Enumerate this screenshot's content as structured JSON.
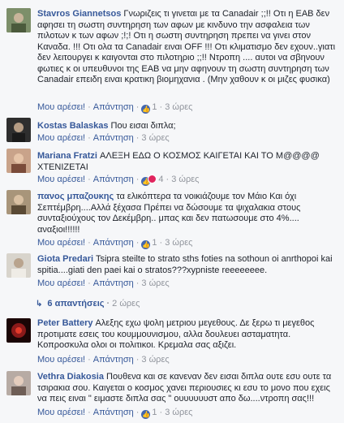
{
  "common": {
    "like_label": "Μου αρέσει!",
    "reply_label": "Απάντηση",
    "dot": "·"
  },
  "comments": [
    {
      "author": "Stavros Giannetsos",
      "text": "Γνωριζεις τι γινεται με τα Canadair ;;!! Οτι η ΕΑΒ δεν αφησει τη σωστη συντηρηση των αφων με κινδυνο την ασφαλεια των πιλοτων κ των αφων ;!;! Οτι η σωστη συντηρηση πρεπει να γινει στον Καναδα. !!! Οτι ολα τα Canadair ειναι OFF !!! Οτι κλιματισμο δεν εχουν..γιατι δεν λειτουργει κ καιγονται στο πιλοτηριο ;;!! Ντροπη .... αυτοι να σβηνουν φωτιες κ οι υπευθυνοι της ΕΑΒ να μην αφηνουν τη σωστη συντηρηση των Canadair επειδη ειναι κρατικη βιομηχανια . (Μην χαθουν κ οι μιζες φυσικα)",
      "reactions": "1",
      "time": "3 ώρες",
      "avatar_color": "#6b7f5a"
    },
    {
      "author": "Kostas Balaskas",
      "text": "Που εισαι διπλα;",
      "time": "3 ώρες",
      "avatar_color": "#3c3c3c"
    },
    {
      "author": "Mariana Fratzi",
      "text": "ΑΛΕΞΗ ΕΔΩ Ο ΚΟΣΜΟΣ ΚΑΙΓΕΤΑΙ ΚΑΙ ΤΟ Μ@@@@ ΧΤΕΝΙΖΕΤΑΙ",
      "reactions": "4",
      "time": "3 ώρες",
      "avatar_color": "#b2876a"
    },
    {
      "author": "πανος μπαζουκης",
      "text": "τα ελικόπτερα τα νοικιάζουμε τον Μάιο Και όχι Σεπτέμβρη....Αλλά ξέχασα Πρέπει να δώσουμε τα ψιχαλακια στους συνταξιούχους τον Δεκέμβρη.. μπας και δεν πατωσουμε στο 4%.... αναξιοι!!!!!!",
      "reactions": "1",
      "time": "3 ώρες",
      "avatar_color": "#8a7b5c"
    },
    {
      "author": "Giota Predari",
      "text": "Tsipra steilte to strato sths foties na sothoun oi anrthopoi kai spitia....giati den paei kai o stratos???xypniste reeeeeeee.",
      "time": "3 ώρες",
      "avatar_color": "#c9c6bf"
    },
    {
      "author": "Peter Battery",
      "text": "Αλεξης εχω ψολη μετριου μεγεθους. Δε ξερω τι μεγεθος προτιματε εσεις του κουμμουνισμου, αλλα δουλευει ασταματητα. Κοπροσκυλα ολοι οι πολιτικοι. Κρεμαλα σας αξιζει.",
      "time": "3 ώρες",
      "avatar_color": "#7a1010"
    },
    {
      "author": "Vethra Diakosia",
      "text": "Πουθενα και σε κανεναν δεν εισαι διπλα ουτε εσυ ουτε τα τσιρακια σου. Καιγεται ο κοσμος χανει περιουσιες κι εσυ το μονο που εχεις να πεις ειναι \" ειμαστε διπλα σας \" ουυυυυυστ απο δω....ντροπη σας!!!",
      "reactions": "1",
      "time": "3 ώρες",
      "avatar_color": "#9e8e86"
    }
  ],
  "replies_link": {
    "label": "6 απαντήσεις",
    "time": "2 ώρες"
  },
  "icons": {
    "like": "thumbs-up-icon",
    "love": "heart-icon",
    "wow": "wow-icon",
    "reply_arrow": "reply-arrow-icon"
  },
  "colors": {
    "author": "#365899",
    "meta": "#90949c",
    "like_badge": "#4267b2",
    "love_badge": "#e0245e",
    "wow_badge": "#f7b125"
  }
}
